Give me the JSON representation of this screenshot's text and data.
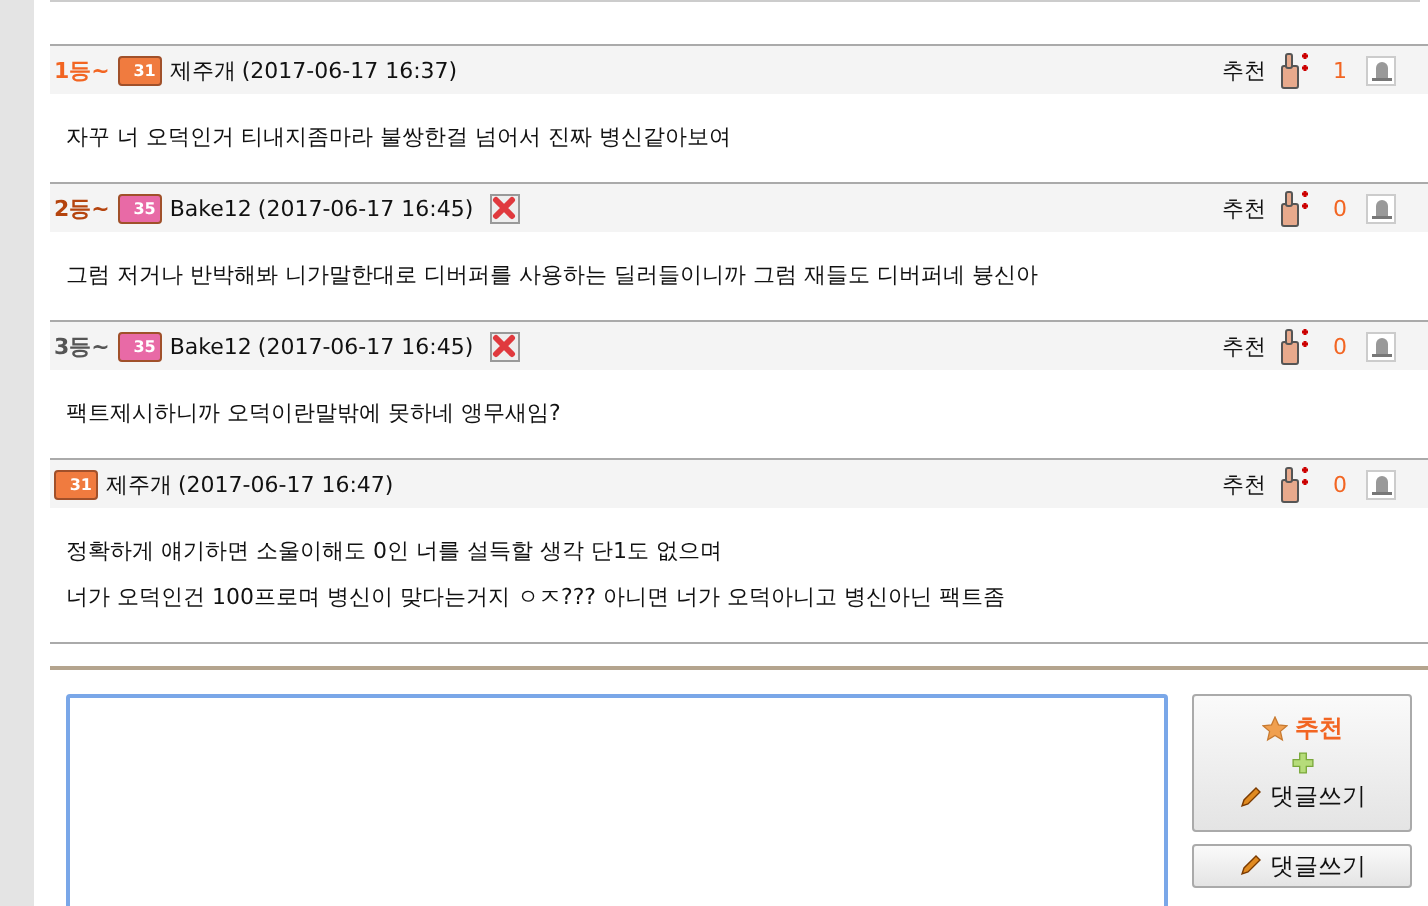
{
  "comments": [
    {
      "rank": {
        "text": "1등~",
        "color": "#f26522"
      },
      "level_badge": {
        "text": "31",
        "color": "#f07b3f"
      },
      "author": "제주개",
      "time": "(2017-06-17 16:37)",
      "deletable": false,
      "recommend_label": "추천",
      "count": "1",
      "lines": [
        "자꾸 너 오덕인거 티내지좀마라 불쌍한걸 넘어서 진짜 병신같아보여"
      ]
    },
    {
      "rank": {
        "text": "2등~",
        "color": "#b5440e"
      },
      "level_badge": {
        "text": "35",
        "color": "#e86aa6"
      },
      "author": "Bake12",
      "time": "(2017-06-17 16:45)",
      "deletable": true,
      "recommend_label": "추천",
      "count": "0",
      "lines": [
        "그럼 저거나 반박해봐 니가말한대로 디버퍼를 사용하는 딜러들이니까 그럼 재들도 디버퍼네 븅신아"
      ]
    },
    {
      "rank": {
        "text": "3등~",
        "color": "#555555"
      },
      "level_badge": {
        "text": "35",
        "color": "#e86aa6"
      },
      "author": "Bake12",
      "time": "(2017-06-17 16:45)",
      "deletable": true,
      "recommend_label": "추천",
      "count": "0",
      "lines": [
        "팩트제시하니까 오덕이란말밖에 못하네 앵무새임?"
      ]
    },
    {
      "level_badge": {
        "text": "31",
        "color": "#f07b3f"
      },
      "author": "제주개",
      "time": "(2017-06-17 16:47)",
      "deletable": false,
      "recommend_label": "추천",
      "count": "0",
      "lines": [
        "정확하게 얘기하면 소울이해도 0인 너를 설득할 생각 단1도 없으며",
        "너가 오덕인건 100프로며 병신이 맞다는거지 ㅇㅈ??? 아니면 너가 오덕아니고 병신아닌 팩트좀"
      ]
    }
  ],
  "composer": {
    "recommend_button": "추천",
    "write_label": "댓글쓰기",
    "write_button": "댓글쓰기"
  }
}
